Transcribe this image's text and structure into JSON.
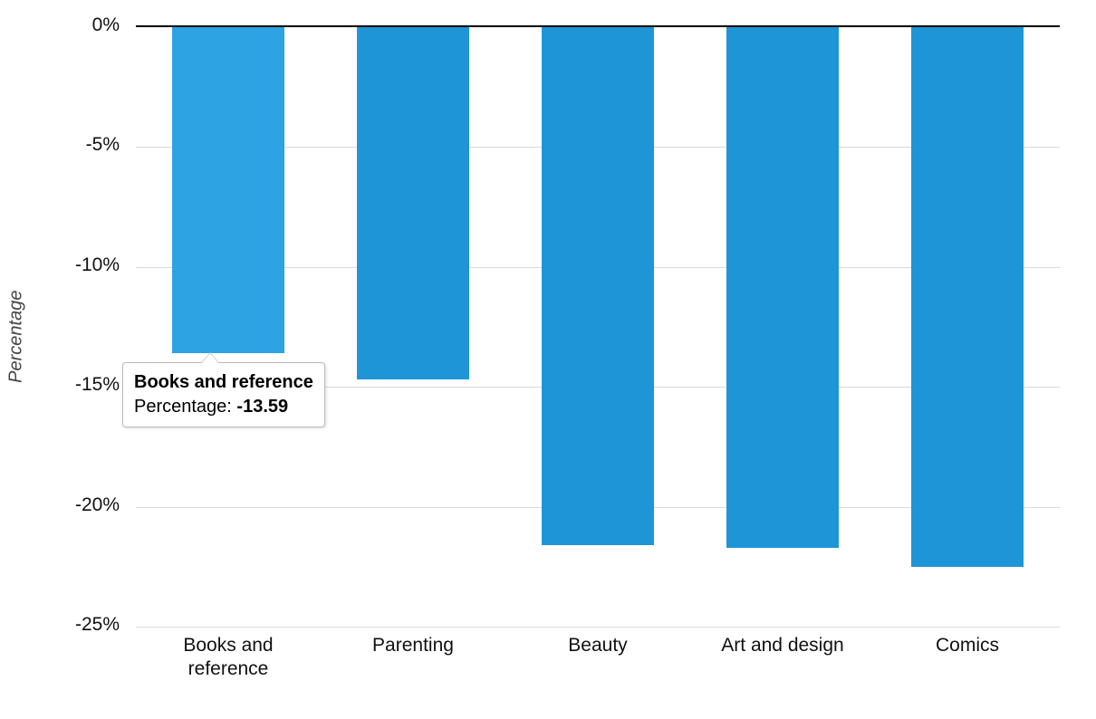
{
  "chart_data": {
    "type": "bar",
    "categories": [
      "Books and reference",
      "Parenting",
      "Beauty",
      "Art and design",
      "Comics"
    ],
    "values": [
      -13.59,
      -14.7,
      -21.6,
      -21.7,
      -22.5
    ],
    "ylabel": "Percentage",
    "ylim": [
      -25,
      0
    ],
    "y_ticks": [
      0,
      -5,
      -10,
      -15,
      -20,
      -25
    ],
    "y_tick_labels": [
      "0%",
      "-5%",
      "-10%",
      "-15%",
      "-20%",
      "-25%"
    ],
    "bar_color": "#1e95d6"
  },
  "tooltip": {
    "title": "Books and reference",
    "series_label": "Percentage:",
    "value": "-13.59",
    "target_index": 0
  }
}
